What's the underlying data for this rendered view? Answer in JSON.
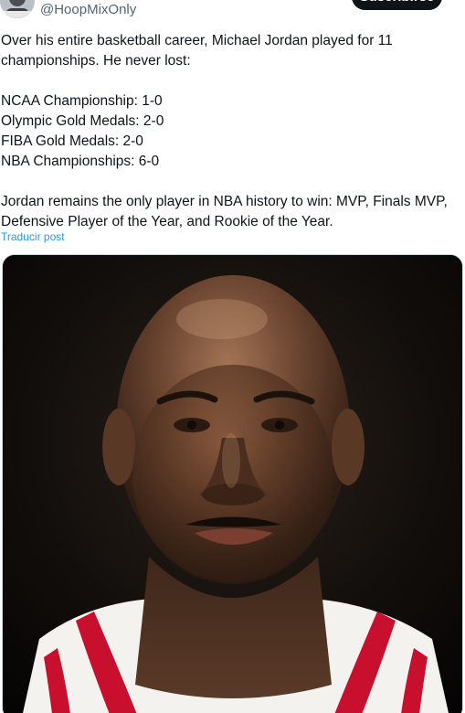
{
  "header": {
    "handle": "@HoopMixOnly",
    "subscribe_label": "Suscribirse"
  },
  "post": {
    "lines": [
      "Over his entire basketball career, Michael Jordan played for 11",
      "championships. He never lost:",
      "",
      "NCAA Championship: 1-0",
      "Olympic Gold Medals: 2-0",
      "FIBA Gold Medals: 2-0",
      "NBA Championships: 6-0",
      "",
      "Jordan remains the only player in NBA history to win: MVP, Finals MVP,",
      "Defensive Player of the Year, and Rookie of the Year."
    ],
    "translate_label": "Traducir post"
  },
  "media": {
    "icon": "photo-portrait",
    "jersey_colors": {
      "base": "#f4f2ee",
      "trim": "#c8102e"
    }
  },
  "colors": {
    "text": "#0f1419",
    "secondary": "#536471",
    "link": "#1d9bf0",
    "button": "#0f1419"
  }
}
